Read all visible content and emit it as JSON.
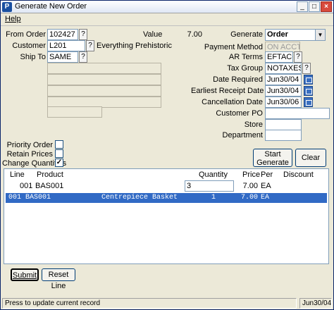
{
  "window": {
    "title": "Generate New Order",
    "app_icon": "P"
  },
  "menu": {
    "help": "Help"
  },
  "form": {
    "from_order": {
      "label": "From Order",
      "value": "102427"
    },
    "customer": {
      "label": "Customer",
      "value": "L201",
      "name": "Everything Prehistoric"
    },
    "ship_to": {
      "label": "Ship To",
      "value": "SAME"
    },
    "value": {
      "label": "Value",
      "amount": "7.00"
    },
    "generate": {
      "label": "Generate",
      "selected": "Order"
    },
    "payment_method": {
      "label": "Payment Method",
      "value": "ON ACCT"
    },
    "ar_terms": {
      "label": "AR Terms",
      "value": "EFTACC"
    },
    "tax_group": {
      "label": "Tax Group",
      "value": "NOTAXES"
    },
    "date_required": {
      "label": "Date Required",
      "value": "Jun30/04"
    },
    "earliest_receipt": {
      "label": "Earliest Receipt Date",
      "value": "Jun30/04"
    },
    "cancellation": {
      "label": "Cancellation Date",
      "value": "Jun30/06"
    },
    "customer_po": {
      "label": "Customer PO",
      "value": ""
    },
    "store": {
      "label": "Store",
      "value": ""
    },
    "department": {
      "label": "Department",
      "value": ""
    },
    "lookup_symbol": "?",
    "priority_order": {
      "label": "Priority Order",
      "checked": false
    },
    "retain_prices": {
      "label": "Retain Prices",
      "checked": false
    },
    "change_quantities": {
      "label": "Change Quantities",
      "checked": true,
      "mark": "✓"
    },
    "start_generate": {
      "line1": "Start",
      "line2": "Generate"
    },
    "clear": "Clear"
  },
  "lines": {
    "headers": {
      "line": "Line",
      "product": "Product",
      "quantity": "Quantity",
      "price": "Price",
      "per": "Per",
      "discount": "Discount"
    },
    "edit_row": {
      "line": "001",
      "product": "BAS001",
      "quantity": "3",
      "price": "7.00",
      "per": "EA"
    },
    "selected_row": {
      "line": "001",
      "product": "BAS001",
      "description": "Centrepiece Basket",
      "quantity": "1",
      "price": "7.00",
      "per": "EA"
    }
  },
  "actions": {
    "submit": "Submit",
    "reset_line": "Reset Line"
  },
  "status": {
    "message": "Press to update current record",
    "date": "Jun30/04"
  }
}
